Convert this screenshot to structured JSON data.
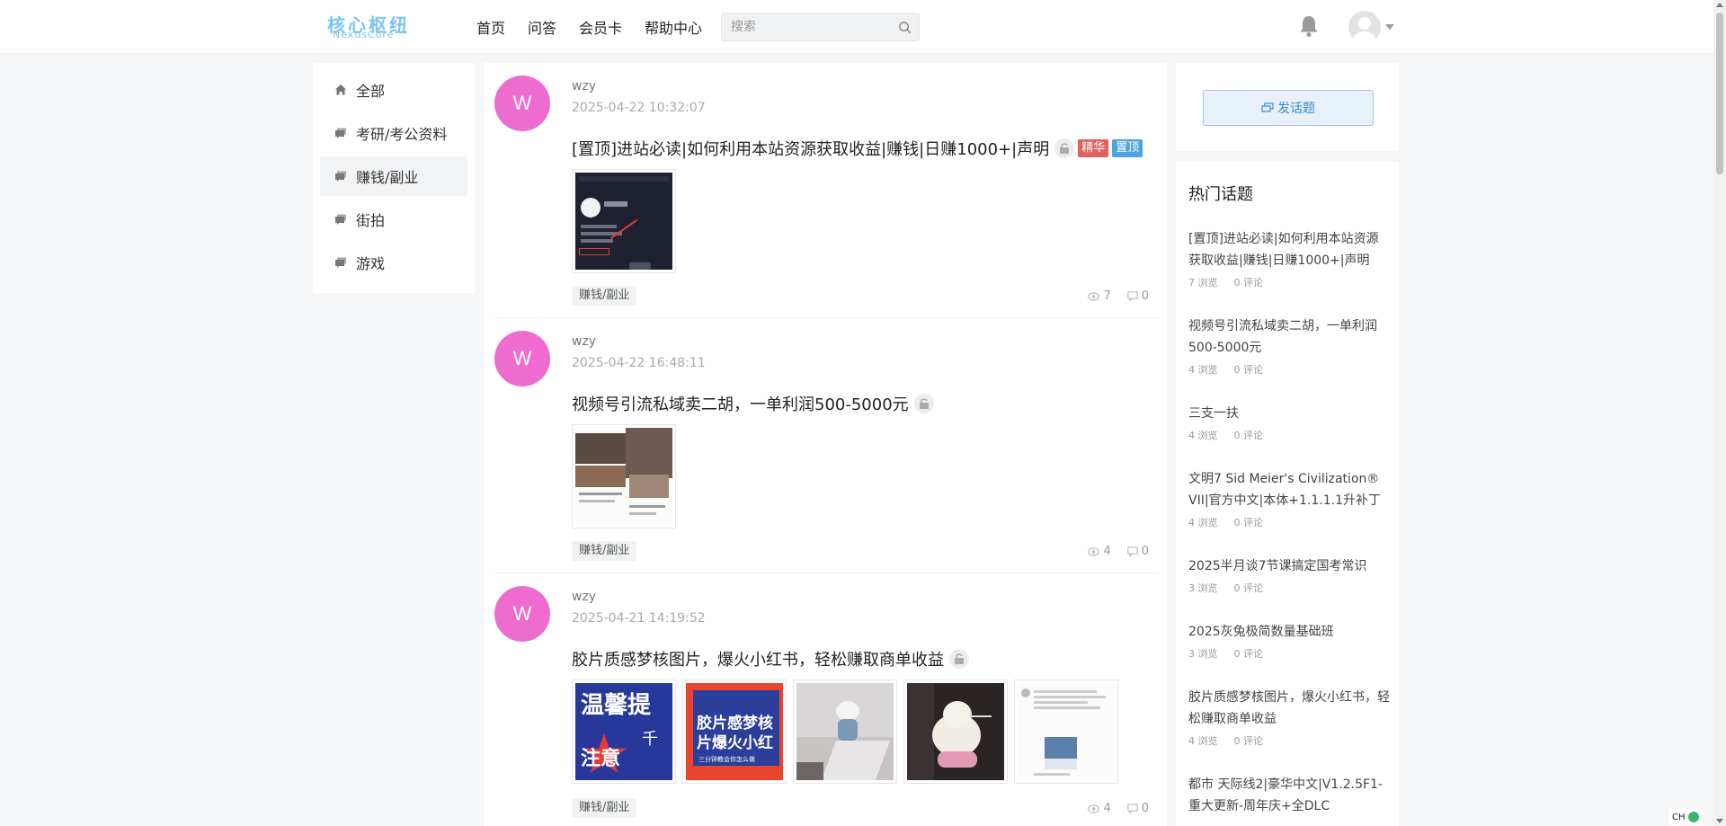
{
  "header": {
    "logo_cn": "核心枢纽",
    "logo_en": "NexusCore",
    "nav": [
      "首页",
      "问答",
      "会员卡",
      "帮助中心"
    ],
    "search_placeholder": "搜索"
  },
  "sidebar": {
    "items": [
      {
        "label": "全部",
        "icon": "home-icon"
      },
      {
        "label": "考研/考公资料",
        "icon": "chat-icon"
      },
      {
        "label": "赚钱/副业",
        "icon": "chat-icon",
        "active": true
      },
      {
        "label": "街拍",
        "icon": "chat-icon"
      },
      {
        "label": "游戏",
        "icon": "chat-icon"
      }
    ]
  },
  "posts": [
    {
      "avatar_letter": "W",
      "author": "wzy",
      "time": "2025-04-22 10:32:07",
      "title": "[置顶]进站必读|如何利用本站资源获取收益|赚钱|日赚1000+|声明",
      "badges": [
        "精华",
        "置顶"
      ],
      "tag": "赚钱/副业",
      "views": "7",
      "comments": "0"
    },
    {
      "avatar_letter": "W",
      "author": "wzy",
      "time": "2025-04-22 16:48:11",
      "title": "视频号引流私域卖二胡，一单利润500-5000元",
      "tag": "赚钱/副业",
      "views": "4",
      "comments": "0"
    },
    {
      "avatar_letter": "W",
      "author": "wzy",
      "time": "2025-04-21 14:19:52",
      "title": "胶片质感梦核图片，爆火小红书，轻松赚取商单收益",
      "tag": "赚钱/副业",
      "views": "4",
      "comments": "0",
      "thumb_texts": {
        "t1a": "温馨提",
        "t1b": "千",
        "t1c": "注意",
        "t2a": "胶片感梦核",
        "t2b": "片爆火小红",
        "t2c": "三分钟教会你怎么做"
      }
    }
  ],
  "right": {
    "post_button": "发话题",
    "hot_title": "热门话题",
    "hot_items": [
      {
        "title": "[置顶]进站必读|如何利用本站资源获取收益|赚钱|日赚1000+|声明",
        "views": "7 浏览",
        "comments": "0 评论"
      },
      {
        "title": "视频号引流私域卖二胡，一单利润500-5000元",
        "views": "4 浏览",
        "comments": "0 评论"
      },
      {
        "title": "三支一扶",
        "views": "4 浏览",
        "comments": "0 评论"
      },
      {
        "title": "文明7 Sid Meier's Civilization® VII|官方中文|本体+1.1.1.1升补丁",
        "views": "4 浏览",
        "comments": "0 评论"
      },
      {
        "title": "2025半月谈7节课搞定国考常识",
        "views": "3 浏览",
        "comments": "0 评论"
      },
      {
        "title": "2025灰兔极简数量基础班",
        "views": "3 浏览",
        "comments": "0 评论"
      },
      {
        "title": "胶片质感梦核图片，爆火小红书，轻松赚取商单收益",
        "views": "4 浏览",
        "comments": "0 评论"
      },
      {
        "title": "都市 天际线2|豪华中文|V1.2.5F1-重大更新-周年庆+全DLC",
        "views": "",
        "comments": ""
      }
    ]
  },
  "ime": {
    "label": "CH"
  },
  "colors": {
    "avatar": "#ee6cd0",
    "accent": "#3a8ad6",
    "badge_red": "#e0625e",
    "badge_blue": "#4fa3e0",
    "logo": "#7ec3f0"
  }
}
